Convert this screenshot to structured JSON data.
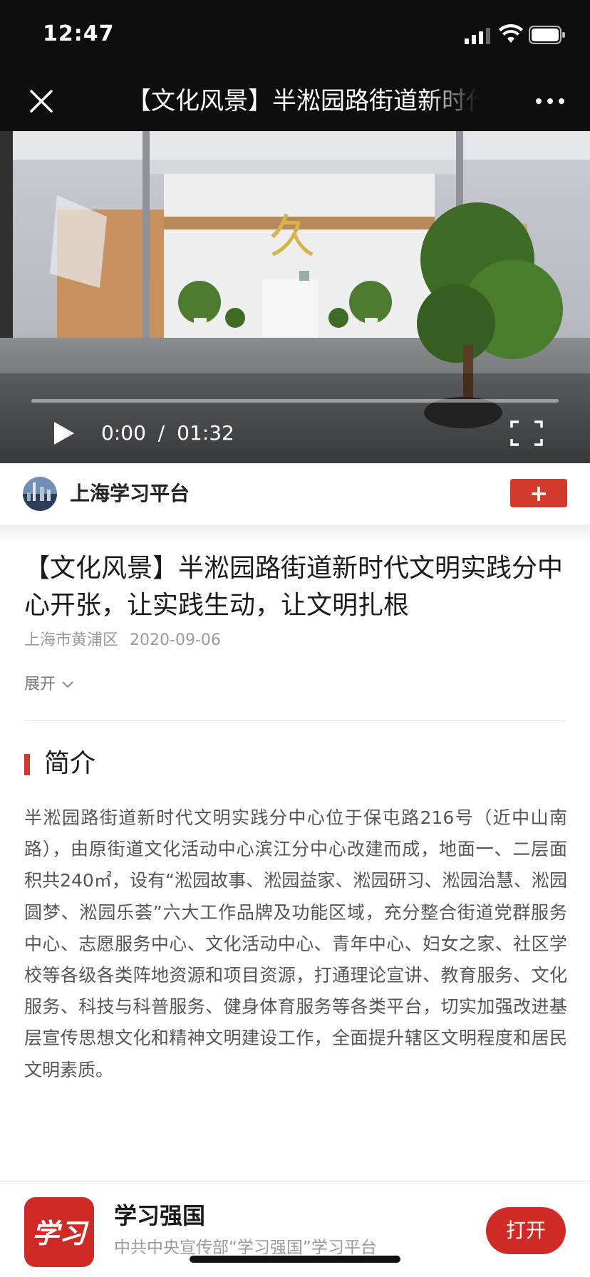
{
  "status_bar": {
    "time": "12:47"
  },
  "nav": {
    "title": "【文化风景】半淞园路街道新时代文明实践分中心开张，让实践生动，让文明扎根"
  },
  "video": {
    "current_time": "0:00",
    "separator": "/",
    "duration": "01:32",
    "progress": 0
  },
  "channel": {
    "name": "上海学习平台",
    "follow_label": "+"
  },
  "article": {
    "title": "【文化风景】半淞园路街道新时代文明实践分中心开张，让实践生动，让文明扎根",
    "source": "上海市黄浦区",
    "date": "2020-09-06",
    "expand_label": "展开"
  },
  "intro": {
    "heading": "简介",
    "body": "半淞园路街道新时代文明实践分中心位于保屯路216号（近中山南路），由原街道文化活动中心滨江分中心改建而成，地面一、二层面积共240㎡，设有“淞园故事、淞园益家、淞园研习、淞园治慧、淞园圆梦、淞园乐荟”六大工作品牌及功能区域，充分整合街道党群服务中心、志愿服务中心、文化活动中心、青年中心、妇女之家、社区学校等各级各类阵地资源和项目资源，打通理论宣讲、教育服务、文化服务、科技与科普服务、健身体育服务等各类平台，切实加强改进基层宣传思想文化和精神文明建设工作，全面提升辖区文明程度和居民文明素质。"
  },
  "app_banner": {
    "name": "学习强国",
    "description": "中共中央宣传部“学习强国”学习平台",
    "open_label": "打开",
    "logo_text": "学习"
  },
  "colors": {
    "accent": "#d23a2d",
    "dark_bar": "#0e0e0e"
  }
}
